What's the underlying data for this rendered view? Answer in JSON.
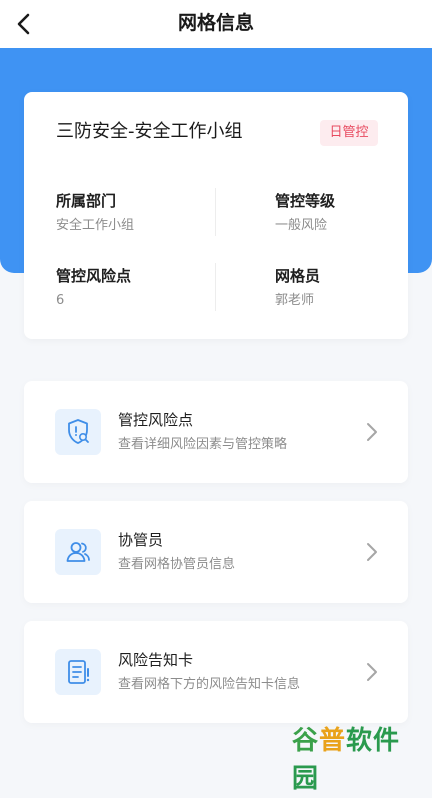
{
  "header": {
    "title": "网格信息"
  },
  "grid": {
    "name": "三防安全-安全工作小组",
    "badge": "日管控",
    "fields": [
      {
        "label": "所属部门",
        "value": "安全工作小组"
      },
      {
        "label": "管控等级",
        "value": "一般风险"
      },
      {
        "label": "管控风险点",
        "value": "6"
      },
      {
        "label": "网格员",
        "value": "郭老师"
      }
    ]
  },
  "menu": [
    {
      "title": "管控风险点",
      "desc": "查看详细风险因素与管控策略",
      "icon": "shield-search-icon"
    },
    {
      "title": "协管员",
      "desc": "查看网格协管员信息",
      "icon": "users-icon"
    },
    {
      "title": "风险告知卡",
      "desc": "查看网格下方的风险告知卡信息",
      "icon": "notice-card-icon"
    }
  ],
  "watermark": {
    "part1": "谷",
    "part2": "普",
    "part3": "软件园"
  },
  "colors": {
    "primary": "#3f93f3",
    "badge_bg": "#fdecef",
    "badge_text": "#e84a5f",
    "icon_bg": "#e8f2fd",
    "icon_stroke": "#3f8ee8"
  }
}
